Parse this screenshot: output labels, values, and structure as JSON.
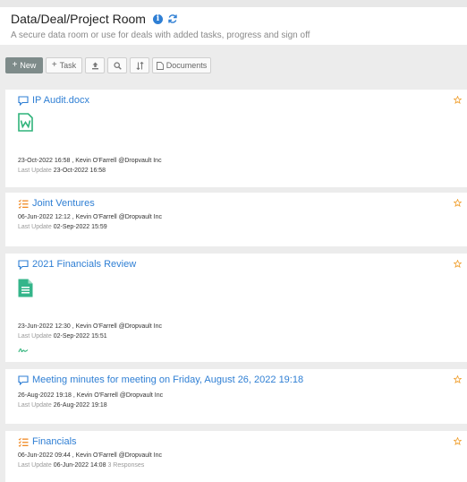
{
  "page": {
    "title": "Data/Deal/Project Room",
    "subtitle": "A secure data room or use for deals with added tasks, progress and sign off"
  },
  "toolbar": {
    "new_label": "New",
    "task_label": "Task",
    "upload_icon": "upload-icon",
    "search_icon": "search-icon",
    "sort_icon": "sort-icon",
    "documents_label": "Documents"
  },
  "items": [
    {
      "title": "IP Audit.docx",
      "type": "document",
      "icon": "word-file-icon",
      "created": "23-Oct-2022 16:58 , Kevin O'Farrell @Dropvault Inc",
      "update_label": "Last Update",
      "update_date": "23-Oct-2022 16:58",
      "responses": ""
    },
    {
      "title": "Joint Ventures",
      "type": "task-list",
      "icon": "task-list-icon",
      "created": "06-Jun-2022 12:12 , Kevin O'Farrell @Dropvault Inc",
      "update_label": "Last Update",
      "update_date": "02-Sep-2022 15:59",
      "responses": ""
    },
    {
      "title": "2021 Financials Review",
      "type": "document",
      "icon": "sheet-file-icon",
      "created": "23-Jun-2022 12:30 , Kevin O'Farrell @Dropvault Inc",
      "update_label": "Last Update",
      "update_date": "02-Sep-2022 15:51",
      "responses": ""
    },
    {
      "title": "Meeting minutes for meeting on Friday, August 26, 2022 19:18",
      "type": "discussion",
      "icon": "comment-icon",
      "created": "26-Aug-2022 19:18 , Kevin O'Farrell @Dropvault Inc",
      "update_label": "Last Update",
      "update_date": "26-Aug-2022 19:18",
      "responses": ""
    },
    {
      "title": "Financials",
      "type": "task-list",
      "icon": "task-list-icon",
      "created": "06-Jun-2022 09:44 , Kevin O'Farrell @Dropvault Inc",
      "update_label": "Last Update",
      "update_date": "06-Jun-2022 14:08",
      "responses": "3 Responses"
    }
  ],
  "colors": {
    "accent": "#2f7fd4",
    "star": "#f0a030",
    "task": "#f08a24",
    "word_file": "#2fb37a",
    "sheet_file": "#34b58a",
    "primary_button": "#7e8b8a"
  }
}
